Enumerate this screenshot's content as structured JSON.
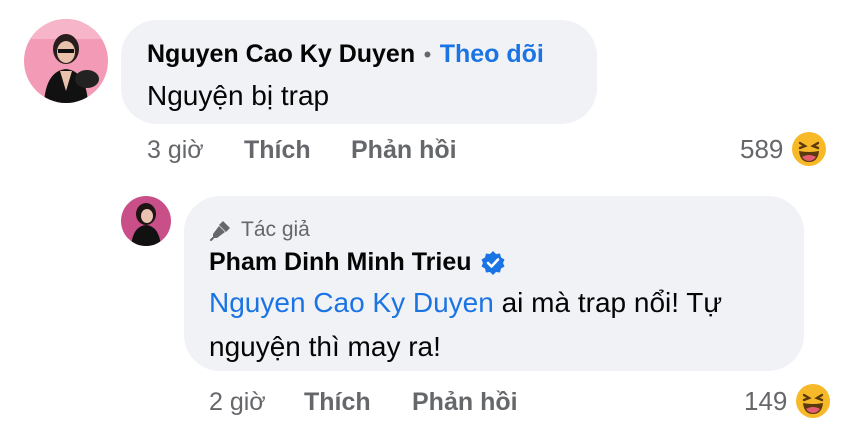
{
  "comment": {
    "author": "Nguyen Cao Ky Duyen",
    "separator": "•",
    "follow_label": "Theo dõi",
    "text": "Nguyện bị trap",
    "time": "3 giờ",
    "like_label": "Thích",
    "reply_label": "Phản hồi",
    "reaction_count": "589",
    "reaction_icon": "laugh-emoji-icon"
  },
  "reply": {
    "author_tag": "Tác giả",
    "author": "Pham Dinh Minh Trieu",
    "verified_icon": "verified-badge-icon",
    "mention": "Nguyen Cao Ky Duyen",
    "text_line1_rest": " ai mà trap nổi! Tự",
    "text_line2": "nguyện thì may ra!",
    "time": "2 giờ",
    "like_label": "Thích",
    "reply_label": "Phản hồi",
    "reaction_count": "149",
    "reaction_icon": "laugh-emoji-icon"
  },
  "colors": {
    "bubble": "#f0f2f5",
    "link_blue": "#1b74e4",
    "secondary_text": "#65676b",
    "emoji_yellow": "#f7b928"
  }
}
